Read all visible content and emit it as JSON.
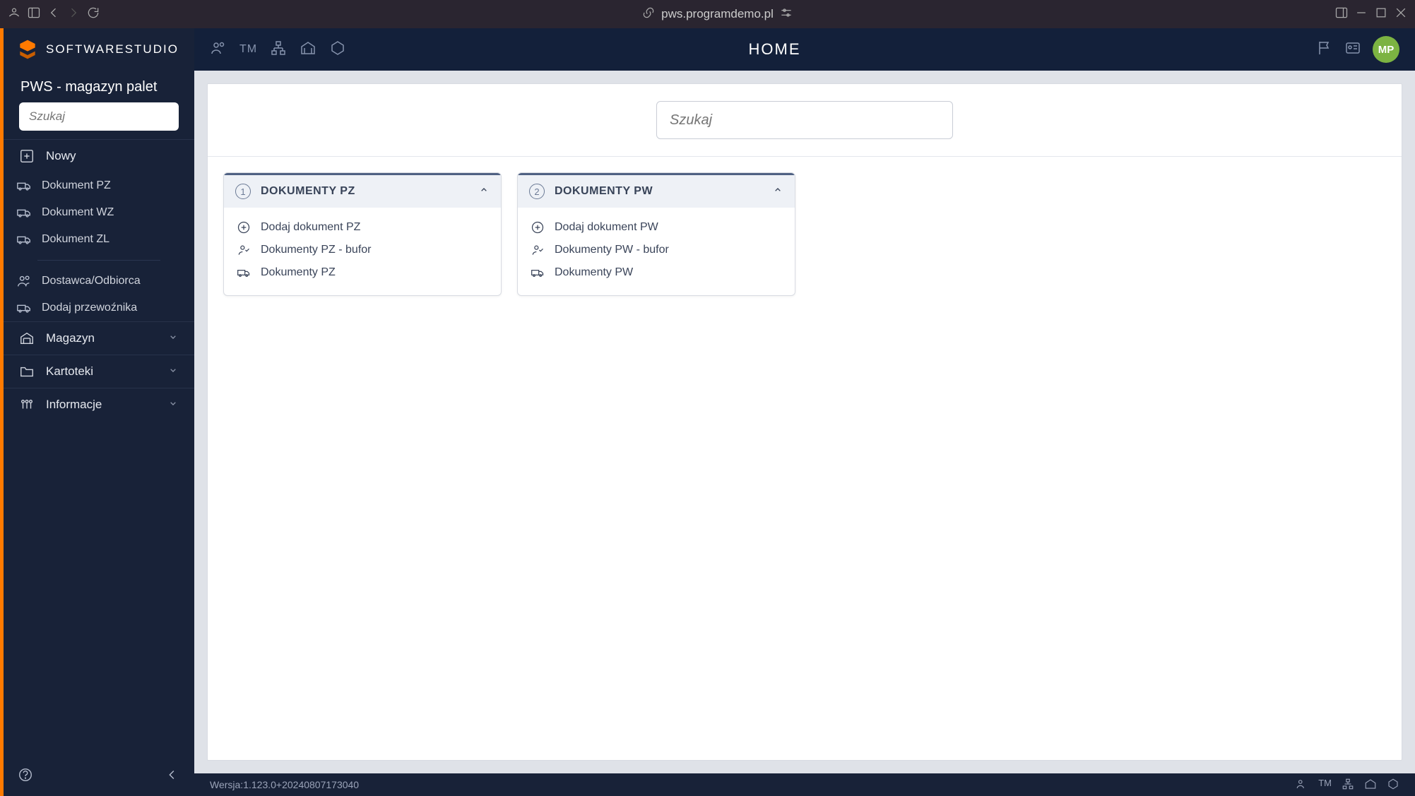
{
  "browser": {
    "url": "pws.programdemo.pl"
  },
  "logo_text": "SOFTWARESTUDIO",
  "app_title": "PWS - magazyn palet",
  "sidebar_search_placeholder": "Szukaj",
  "sections": {
    "nowy": {
      "label": "Nowy",
      "items": [
        "Dokument PZ",
        "Dokument WZ",
        "Dokument ZL"
      ],
      "actions": [
        "Dostawca/Odbiorca",
        "Dodaj przewoźnika"
      ]
    },
    "magazyn": {
      "label": "Magazyn"
    },
    "kartoteki": {
      "label": "Kartoteki"
    },
    "informacje": {
      "label": "Informacje"
    }
  },
  "page_title": "HOME",
  "avatar_initials": "MP",
  "main_search_placeholder": "Szukaj",
  "panels": [
    {
      "num": "1",
      "title": "DOKUMENTY PZ",
      "items": [
        "Dodaj dokument PZ",
        "Dokumenty PZ - bufor",
        "Dokumenty PZ"
      ]
    },
    {
      "num": "2",
      "title": "DOKUMENTY PW",
      "items": [
        "Dodaj dokument PW",
        "Dokumenty PW - bufor",
        "Dokumenty PW"
      ]
    }
  ],
  "version": "Wersja:1.123.0+20240807173040",
  "topbar_tm": "TM",
  "statusbar_tm": "TM"
}
